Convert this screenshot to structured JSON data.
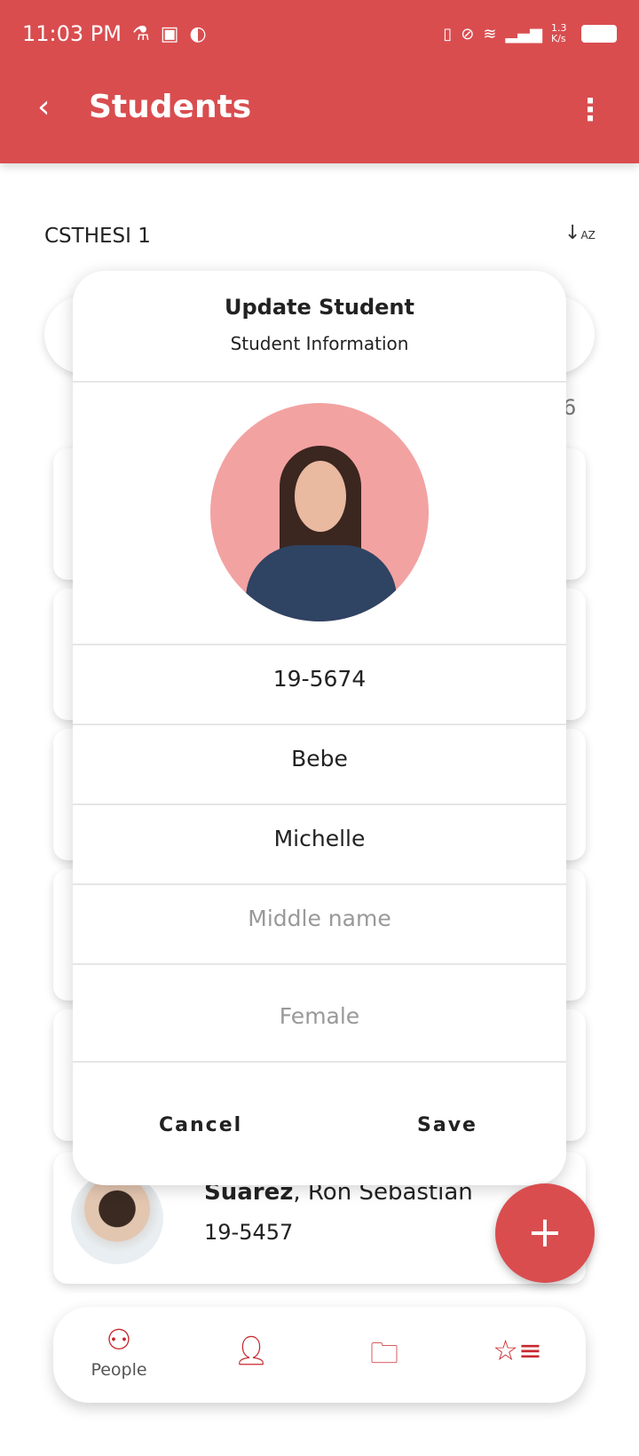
{
  "status_bar": {
    "time": "11:03 PM",
    "net_speed": "1.3 K/s"
  },
  "app_bar": {
    "title": "Students"
  },
  "class": {
    "name": "CSTHESI 1",
    "count_partial": "6"
  },
  "students": [
    {
      "last": "Suarez",
      "first": "Ron Sebastian",
      "id": "19-5457"
    }
  ],
  "dialog": {
    "title": "Update Student",
    "subtitle": "Student Information",
    "student_id": "19-5674",
    "last_name": "Bebe",
    "first_name": "Michelle",
    "middle_name_placeholder": "Middle name",
    "gender": "Female",
    "cancel_label": "Cancel",
    "save_label": "Save"
  },
  "nav": {
    "items": [
      {
        "label": "People",
        "icon": "people-icon"
      },
      {
        "icon": "user-check-icon"
      },
      {
        "icon": "folder-icon"
      },
      {
        "icon": "ranking-icon"
      }
    ]
  },
  "colors": {
    "accent": "#d94d4f",
    "icon": "#c8282e"
  }
}
